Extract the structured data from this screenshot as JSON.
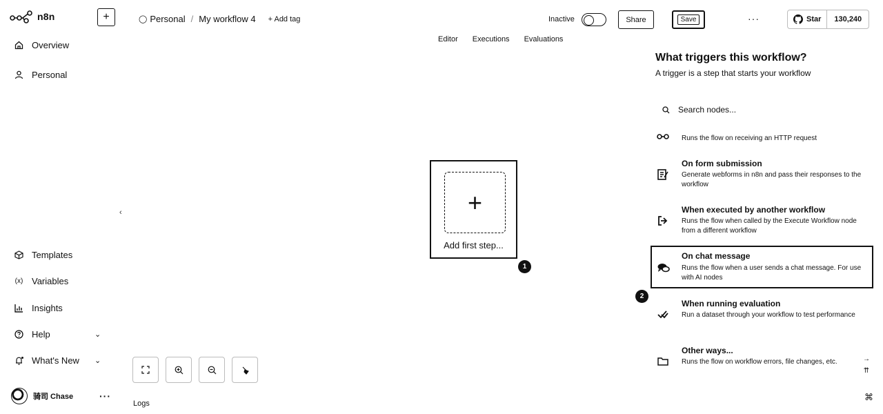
{
  "app": {
    "name": "n8n"
  },
  "sidebar": {
    "new_button": "+",
    "top_items": [
      {
        "label": "Overview",
        "icon": "home-icon"
      },
      {
        "label": "Personal",
        "icon": "user-icon"
      }
    ],
    "bottom_items": [
      {
        "label": "Templates",
        "icon": "box-icon"
      },
      {
        "label": "Variables",
        "icon": "variable-icon"
      },
      {
        "label": "Insights",
        "icon": "bar-chart-icon"
      },
      {
        "label": "Help",
        "icon": "help-icon"
      },
      {
        "label": "What's New",
        "icon": "bell-icon"
      }
    ],
    "user": {
      "name": "骑司 Chase",
      "menu": "···"
    }
  },
  "header": {
    "breadcrumb": {
      "project": "Personal",
      "separator": "/",
      "workflow": "My workflow 4"
    },
    "add_tag": "+ Add tag",
    "status_label": "Inactive",
    "share_label": "Share",
    "save_label": "Save",
    "more": "···",
    "github": {
      "star_label": "Star",
      "count": "130,240"
    }
  },
  "tabs": [
    "Editor",
    "Executions",
    "Evaluations"
  ],
  "canvas": {
    "add_first_step": "Add first step...",
    "badge_1": "1",
    "logs_label": "Logs"
  },
  "panel": {
    "title": "What triggers this workflow?",
    "subtitle": "A trigger is a step that starts your workflow",
    "search_placeholder": "Search nodes...",
    "badge_2": "2",
    "triggers": [
      {
        "title": "",
        "desc": "Runs the flow on receiving an HTTP request",
        "icon": "webhook-icon"
      },
      {
        "title": "On form submission",
        "desc": "Generate webforms in n8n and pass their responses to the workflow",
        "icon": "form-icon"
      },
      {
        "title": "When executed by another workflow",
        "desc": "Runs the flow when called by the Execute Workflow node from a different workflow",
        "icon": "sign-in-icon"
      },
      {
        "title": "On chat message",
        "desc": "Runs the flow when a user sends a chat message. For use with AI nodes",
        "icon": "chat-icon"
      },
      {
        "title": "When running evaluation",
        "desc": "Run a dataset through your workflow to test performance",
        "icon": "check-double-icon"
      },
      {
        "title": "Other ways...",
        "desc": "Runs the flow on workflow errors, file changes, etc.",
        "icon": "folder-icon"
      }
    ]
  }
}
